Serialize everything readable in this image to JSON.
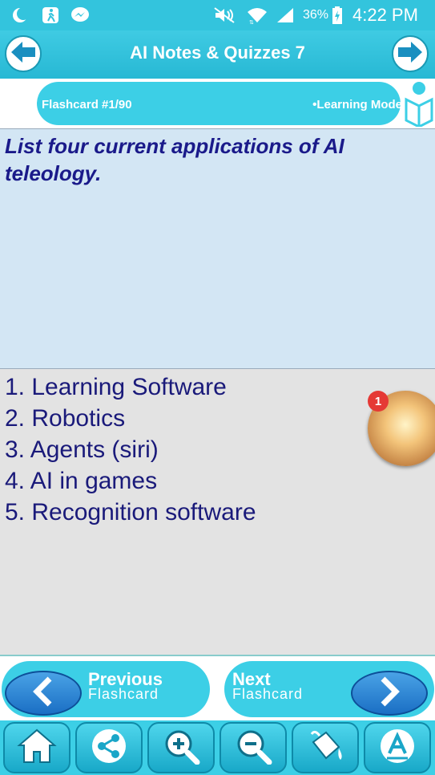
{
  "status_bar": {
    "battery": "36%",
    "time": "4:22 PM"
  },
  "app_bar": {
    "title": "AI Notes & Quizzes 7"
  },
  "flashcard_bar": {
    "counter": "Flashcard #1/90",
    "mode": "•Learning Mode"
  },
  "question": {
    "text": "List four current applications of AI teleology."
  },
  "answer": {
    "lines": [
      "1. Learning Software",
      "2. Robotics",
      "3. Agents (siri)",
      "4. AI in games",
      "5. Recognition software"
    ]
  },
  "chat_bubble": {
    "badge": "1"
  },
  "nav": {
    "previous_main": "Previous",
    "previous_sub": "Flashcard",
    "next_main": "Next",
    "next_sub": "Flashcard"
  },
  "toolbar": {
    "items": [
      "home-icon",
      "share-icon",
      "zoom-in-icon",
      "zoom-out-icon",
      "paint-bucket-icon",
      "font-icon"
    ]
  },
  "colors": {
    "accent": "#3ccfe6",
    "question_bg": "#d3e6f4",
    "answer_bg": "#e3e3e3",
    "text_dark_blue": "#1a1a7a"
  }
}
